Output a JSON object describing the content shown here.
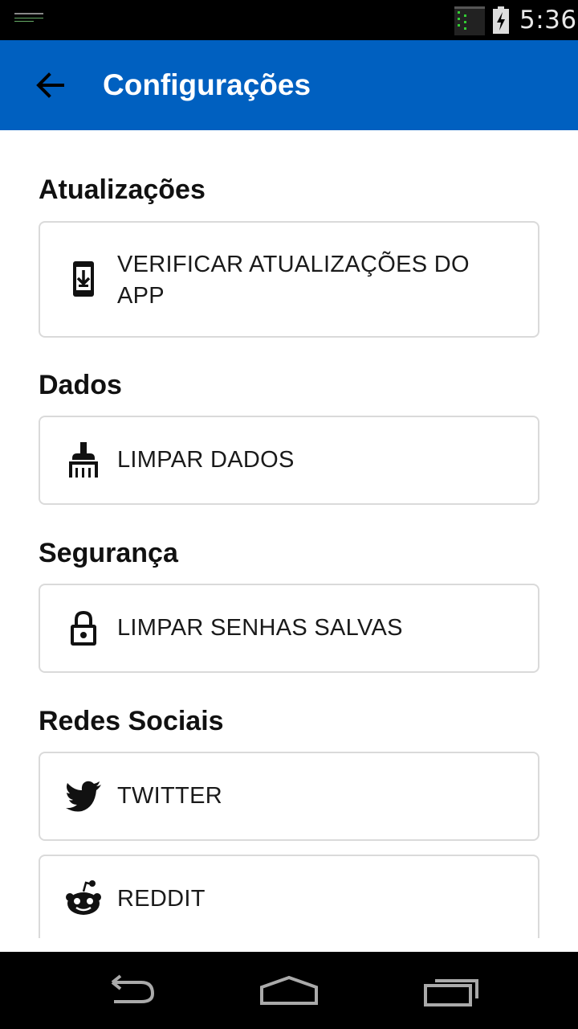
{
  "status_bar": {
    "time": "5:36",
    "icons": [
      "notification-icon",
      "signal-icon",
      "battery-charging-icon"
    ]
  },
  "app_bar": {
    "title": "Configurações",
    "back_icon": "arrow-back-icon"
  },
  "sections": [
    {
      "title": "Atualizações",
      "items": [
        {
          "label": "VERIFICAR ATUALIZAÇÕES DO APP",
          "icon": "phone-download-icon"
        }
      ]
    },
    {
      "title": "Dados",
      "items": [
        {
          "label": "LIMPAR DADOS",
          "icon": "broom-icon"
        }
      ]
    },
    {
      "title": "Segurança",
      "items": [
        {
          "label": "LIMPAR SENHAS SALVAS",
          "icon": "lock-icon"
        }
      ]
    },
    {
      "title": "Redes Sociais",
      "items": [
        {
          "label": "TWITTER",
          "icon": "twitter-icon"
        },
        {
          "label": "REDDIT",
          "icon": "reddit-icon"
        }
      ]
    }
  ],
  "nav_bar": {
    "icons": [
      "back-nav-icon",
      "home-nav-icon",
      "recents-nav-icon"
    ]
  },
  "colors": {
    "app_bar": "#0060c0",
    "status_bar": "#000000",
    "card_border": "#dadada"
  }
}
